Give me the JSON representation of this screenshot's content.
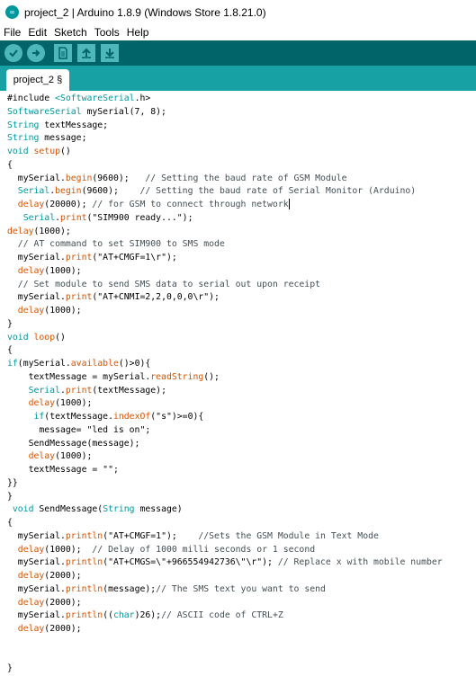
{
  "window": {
    "title": "project_2 | Arduino 1.8.9 (Windows Store 1.8.21.0)",
    "app_icon": "arduino-logo-icon"
  },
  "menu": [
    "File",
    "Edit",
    "Sketch",
    "Tools",
    "Help"
  ],
  "toolbar": {
    "buttons": [
      "verify-icon",
      "upload-icon",
      "new-icon",
      "open-icon",
      "save-icon"
    ]
  },
  "tab": {
    "label": "project_2 §"
  },
  "colors": {
    "toolbar_bg": "#006468",
    "tabstrip_bg": "#17a1a5",
    "button_fg": "#4db7bb",
    "keyword": "#00979c",
    "function": "#d35400",
    "comment": "#434f54"
  },
  "code": [
    [
      [
        "pp",
        "#include "
      ],
      [
        "kw",
        "<SoftwareSerial"
      ],
      [
        "pp",
        ".h>"
      ]
    ],
    [
      [
        "kw",
        "SoftwareSerial"
      ],
      [
        "pp",
        " mySerial(7, 8);"
      ]
    ],
    [
      [
        "kw",
        "String"
      ],
      [
        "pp",
        " textMessage;"
      ]
    ],
    [
      [
        "kw",
        "String"
      ],
      [
        "pp",
        " message;"
      ]
    ],
    [
      [
        "kw",
        "void"
      ],
      [
        "pp",
        " "
      ],
      [
        "fn",
        "setup"
      ],
      [
        "pp",
        "()"
      ]
    ],
    [
      [
        "pp",
        "{"
      ]
    ],
    [
      [
        "pp",
        "  mySerial."
      ],
      [
        "fn",
        "begin"
      ],
      [
        "pp",
        "(9600);   "
      ],
      [
        "cm",
        "// Setting the baud rate of GSM Module"
      ]
    ],
    [
      [
        "pp",
        "  "
      ],
      [
        "kw",
        "Serial"
      ],
      [
        "pp",
        "."
      ],
      [
        "fn",
        "begin"
      ],
      [
        "pp",
        "(9600);    "
      ],
      [
        "cm",
        "// Setting the baud rate of Serial Monitor (Arduino)"
      ]
    ],
    [
      [
        "pp",
        "  "
      ],
      [
        "fn",
        "delay"
      ],
      [
        "pp",
        "(20000); "
      ],
      [
        "cm",
        "// for GSM to connect through network"
      ],
      [
        "cur",
        ""
      ]
    ],
    [
      [
        "pp",
        "   "
      ],
      [
        "kw",
        "Serial"
      ],
      [
        "pp",
        "."
      ],
      [
        "fn",
        "print"
      ],
      [
        "pp",
        "(\"SIM900 ready...\");"
      ]
    ],
    [
      [
        "fn",
        "delay"
      ],
      [
        "pp",
        "(1000);"
      ]
    ],
    [
      [
        "pp",
        "  "
      ],
      [
        "cm",
        "// AT command to set SIM900 to SMS mode"
      ]
    ],
    [
      [
        "pp",
        "  mySerial."
      ],
      [
        "fn",
        "print"
      ],
      [
        "pp",
        "(\"AT+CMGF=1\\r\");"
      ]
    ],
    [
      [
        "pp",
        "  "
      ],
      [
        "fn",
        "delay"
      ],
      [
        "pp",
        "(1000);"
      ]
    ],
    [
      [
        "pp",
        "  "
      ],
      [
        "cm",
        "// Set module to send SMS data to serial out upon receipt"
      ]
    ],
    [
      [
        "pp",
        "  mySerial."
      ],
      [
        "fn",
        "print"
      ],
      [
        "pp",
        "(\"AT+CNMI=2,2,0,0,0\\r\");"
      ]
    ],
    [
      [
        "pp",
        "  "
      ],
      [
        "fn",
        "delay"
      ],
      [
        "pp",
        "(1000);"
      ]
    ],
    [
      [
        "pp",
        "}"
      ]
    ],
    [
      [
        "kw",
        "void"
      ],
      [
        "pp",
        " "
      ],
      [
        "fn",
        "loop"
      ],
      [
        "pp",
        "()"
      ]
    ],
    [
      [
        "pp",
        "{"
      ]
    ],
    [
      [
        "kw",
        "if"
      ],
      [
        "pp",
        "(mySerial."
      ],
      [
        "fn",
        "available"
      ],
      [
        "pp",
        "()>0){"
      ]
    ],
    [
      [
        "pp",
        "    textMessage = mySerial."
      ],
      [
        "fn",
        "readString"
      ],
      [
        "pp",
        "();"
      ]
    ],
    [
      [
        "pp",
        "    "
      ],
      [
        "kw",
        "Serial"
      ],
      [
        "pp",
        "."
      ],
      [
        "fn",
        "print"
      ],
      [
        "pp",
        "(textMessage);"
      ]
    ],
    [
      [
        "pp",
        "    "
      ],
      [
        "fn",
        "delay"
      ],
      [
        "pp",
        "(1000);"
      ]
    ],
    [
      [
        "pp",
        "     "
      ],
      [
        "kw",
        "if"
      ],
      [
        "pp",
        "(textMessage."
      ],
      [
        "fn",
        "indexOf"
      ],
      [
        "pp",
        "(\"s\")>=0){"
      ]
    ],
    [
      [
        "pp",
        "      message= \"led is on\";"
      ]
    ],
    [
      [
        "pp",
        "    SendMessage(message);"
      ]
    ],
    [
      [
        "pp",
        "    "
      ],
      [
        "fn",
        "delay"
      ],
      [
        "pp",
        "(1000);"
      ]
    ],
    [
      [
        "pp",
        "    textMessage = \"\";"
      ]
    ],
    [
      [
        "pp",
        "}}"
      ]
    ],
    [
      [
        "pp",
        "}"
      ]
    ],
    [
      [
        "pp",
        " "
      ],
      [
        "kw",
        "void"
      ],
      [
        "pp",
        " SendMessage("
      ],
      [
        "kw",
        "String"
      ],
      [
        "pp",
        " message)"
      ]
    ],
    [
      [
        "pp",
        "{"
      ]
    ],
    [
      [
        "pp",
        "  mySerial."
      ],
      [
        "fn",
        "println"
      ],
      [
        "pp",
        "(\"AT+CMGF=1\");    "
      ],
      [
        "cm",
        "//Sets the GSM Module in Text Mode"
      ]
    ],
    [
      [
        "pp",
        "  "
      ],
      [
        "fn",
        "delay"
      ],
      [
        "pp",
        "(1000);  "
      ],
      [
        "cm",
        "// Delay of 1000 milli seconds or 1 second"
      ]
    ],
    [
      [
        "pp",
        "  mySerial."
      ],
      [
        "fn",
        "println"
      ],
      [
        "pp",
        "(\"AT+CMGS=\\\"+966554942736\\\"\\r\"); "
      ],
      [
        "cm",
        "// Replace x with mobile number"
      ]
    ],
    [
      [
        "pp",
        "  "
      ],
      [
        "fn",
        "delay"
      ],
      [
        "pp",
        "(2000);"
      ]
    ],
    [
      [
        "pp",
        "  mySerial."
      ],
      [
        "fn",
        "println"
      ],
      [
        "pp",
        "(message);"
      ],
      [
        "cm",
        "// The SMS text you want to send"
      ]
    ],
    [
      [
        "pp",
        "  "
      ],
      [
        "fn",
        "delay"
      ],
      [
        "pp",
        "(2000);"
      ]
    ],
    [
      [
        "pp",
        "  mySerial."
      ],
      [
        "fn",
        "println"
      ],
      [
        "pp",
        "(("
      ],
      [
        "kw",
        "char"
      ],
      [
        "pp",
        ")26);"
      ],
      [
        "cm",
        "// ASCII code of CTRL+Z"
      ]
    ],
    [
      [
        "pp",
        "  "
      ],
      [
        "fn",
        "delay"
      ],
      [
        "pp",
        "(2000);"
      ]
    ],
    [
      [
        "pp",
        ""
      ]
    ],
    [
      [
        "pp",
        ""
      ]
    ],
    [
      [
        "pp",
        "}"
      ]
    ]
  ]
}
